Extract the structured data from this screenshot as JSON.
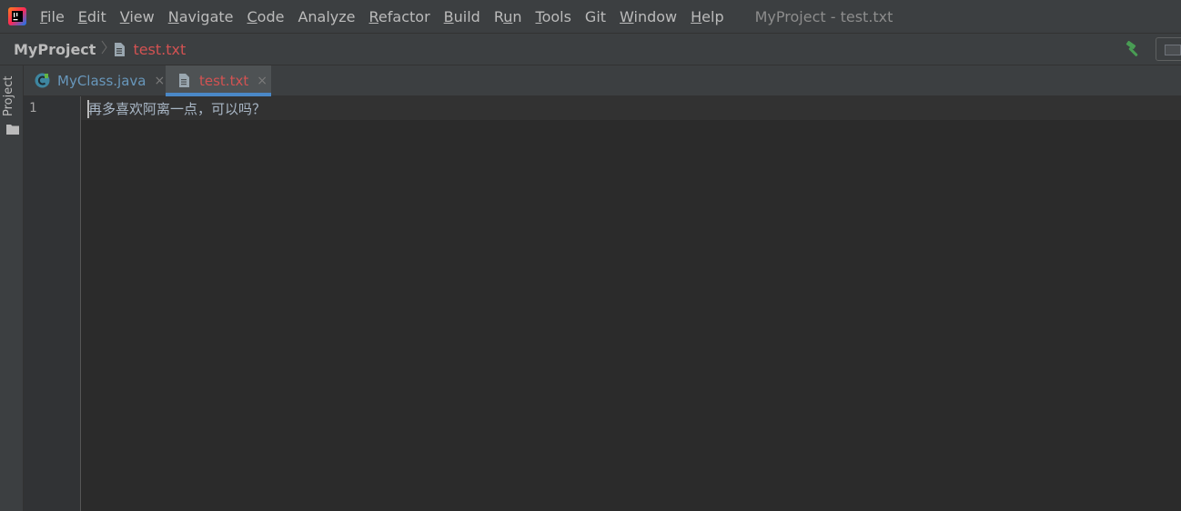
{
  "menubar": {
    "items": [
      {
        "mnemonic": "F",
        "rest": "ile"
      },
      {
        "mnemonic": "E",
        "rest": "dit"
      },
      {
        "mnemonic": "V",
        "rest": "iew"
      },
      {
        "mnemonic": "N",
        "rest": "avigate"
      },
      {
        "mnemonic": "C",
        "rest": "ode"
      },
      {
        "mnemonic": "",
        "rest": "Analyze"
      },
      {
        "mnemonic": "R",
        "rest": "efactor"
      },
      {
        "mnemonic": "B",
        "rest": "uild"
      },
      {
        "pre": "R",
        "mnemonic": "u",
        "rest": "n"
      },
      {
        "mnemonic": "T",
        "rest": "ools"
      },
      {
        "mnemonic": "",
        "rest": "Git"
      },
      {
        "mnemonic": "W",
        "rest": "indow"
      },
      {
        "mnemonic": "H",
        "rest": "elp"
      }
    ],
    "window_title": "MyProject - test.txt"
  },
  "navbar": {
    "project": "MyProject",
    "file": "test.txt",
    "build_icon": "hammer-icon",
    "layout_icon": "layout-icon"
  },
  "left_strip": {
    "project_label": "Project",
    "folder_icon": "folder-icon"
  },
  "tabs": [
    {
      "label": "MyClass.java",
      "icon": "java-class-icon",
      "active": false
    },
    {
      "label": "test.txt",
      "icon": "text-file-icon",
      "active": true
    }
  ],
  "tab_close_glyph": "×",
  "editor": {
    "line_numbers": [
      "1"
    ],
    "lines": [
      "再多喜欢阿离一点，可以吗？"
    ]
  },
  "colors": {
    "accent": "#4a88c7",
    "modified_file": "#d25252",
    "java_file": "#6897bb",
    "build_green": "#499c54"
  }
}
